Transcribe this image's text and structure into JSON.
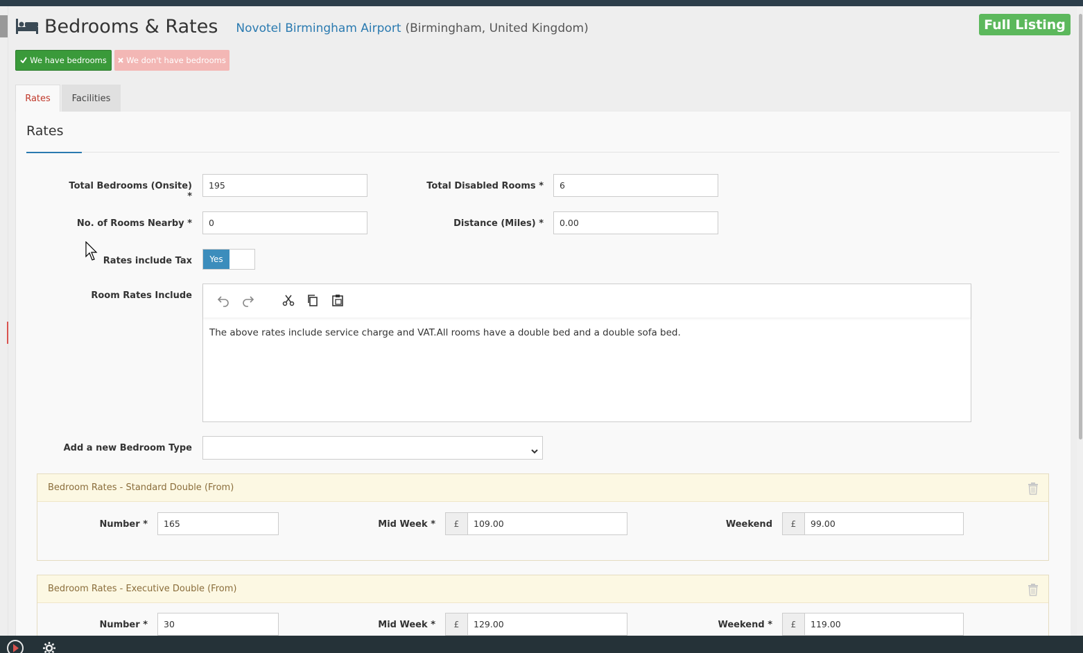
{
  "header": {
    "title": "Bedrooms & Rates",
    "hotel_name": "Novotel Birmingham Airport",
    "hotel_location": "(Birmingham, United Kingdom)",
    "full_listing_label": "Full Listing"
  },
  "bedroom_toggle": {
    "have_label": "We have bedrooms",
    "dont_have_label": "We don't have bedrooms"
  },
  "tabs": [
    {
      "label": "Rates",
      "active": true
    },
    {
      "label": "Facilities",
      "active": false
    }
  ],
  "section": {
    "title": "Rates"
  },
  "form": {
    "total_bedrooms_label": "Total Bedrooms (Onsite)",
    "total_bedrooms_value": "195",
    "total_disabled_label": "Total Disabled Rooms",
    "total_disabled_value": "6",
    "rooms_nearby_label": "No. of Rooms Nearby",
    "rooms_nearby_value": "0",
    "distance_label": "Distance (Miles)",
    "distance_value": "0.00",
    "rates_tax_label": "Rates include Tax",
    "rates_tax_value": "Yes",
    "room_rates_include_label": "Room Rates Include",
    "room_rates_include_text": "The above rates include service charge and VAT.All rooms have a double bed and a double sofa bed.",
    "add_bedroom_type_label": "Add a new Bedroom Type",
    "add_bedroom_type_value": "",
    "required_mark": "*"
  },
  "bedroom_cards": [
    {
      "title": "Bedroom Rates - Standard Double (From)",
      "number_label": "Number",
      "number_value": "165",
      "midweek_label": "Mid Week",
      "midweek_value": "109.00",
      "weekend_label": "Weekend",
      "weekend_value": "99.00",
      "weekend_required": false
    },
    {
      "title": "Bedroom Rates - Executive Double (From)",
      "number_label": "Number",
      "number_value": "30",
      "midweek_label": "Mid Week",
      "midweek_value": "129.00",
      "weekend_label": "Weekend",
      "weekend_value": "119.00",
      "weekend_required": true
    }
  ],
  "currency_symbol": "£",
  "colors": {
    "accent_blue": "#2a7ab0",
    "success_green": "#5cb85c",
    "danger_light": "#f3b7b5",
    "tab_active_text": "#c0392b",
    "card_header_bg": "#fcf8e3"
  },
  "icons": [
    "bed-icon",
    "check-icon",
    "times-icon",
    "undo-icon",
    "redo-icon",
    "cut-icon",
    "copy-icon",
    "paste-icon",
    "chevron-down-icon",
    "trash-icon",
    "play-icon",
    "gear-icon",
    "cursor-icon"
  ]
}
